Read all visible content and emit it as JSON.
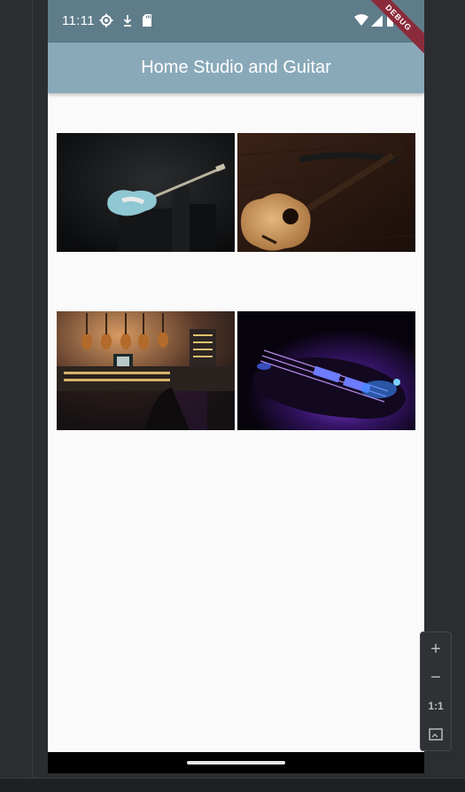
{
  "status_bar": {
    "time": "11:11",
    "left_icons": [
      "settings-gear-icon",
      "download-icon",
      "sd-card-icon"
    ],
    "right_icons": [
      "wifi-icon",
      "signal-icon",
      "battery-icon"
    ]
  },
  "debug_banner": "DEBUG",
  "app_bar": {
    "title": "Home Studio and Guitar"
  },
  "gallery": {
    "images": [
      {
        "name": "electric-guitar-photo",
        "subject": "Light blue electric guitar leaning on an amplifier in a dark room"
      },
      {
        "name": "acoustic-guitar-photo",
        "subject": "Acoustic guitar with strap on a dark wooden surface"
      },
      {
        "name": "home-studio-photo",
        "subject": "Recording studio with mixing console and guitars hanging on the wall"
      },
      {
        "name": "neon-guitar-photo",
        "subject": "Electric guitar lit by purple and blue neon light"
      }
    ]
  },
  "emulator_zoom_controls": {
    "zoom_in": "+",
    "zoom_out": "−",
    "actual_size": "1:1"
  },
  "colors": {
    "status_bar": "#5f7c8a",
    "app_bar": "#89a9b9",
    "background": "#fafafa",
    "debug_ribbon": "#8b2a3a"
  }
}
